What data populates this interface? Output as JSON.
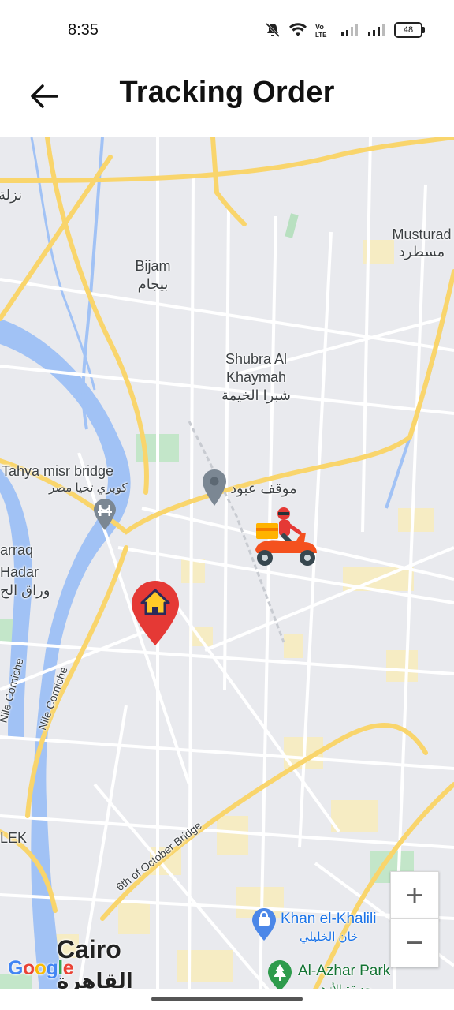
{
  "status": {
    "time": "8:35",
    "battery": "48",
    "icons": [
      "mute-icon",
      "wifi-icon",
      "volte-icon",
      "signal-icon",
      "signal-icon",
      "battery-icon"
    ]
  },
  "header": {
    "title": "Tracking Order",
    "back_icon": "arrow-left-icon"
  },
  "map": {
    "labels": {
      "nazla": "نزلة",
      "musturad_en": "Musturad",
      "musturad_ar": "مسطرد",
      "bijam_en": "Bijam",
      "bijam_ar": "بيجام",
      "shubra_en_1": "Shubra Al",
      "shubra_en_2": "Khaymah",
      "shubra_ar": "شبرا الخيمة",
      "bridge_en": "Tahya misr bridge",
      "bridge_ar": "كوبري تحيا مصر",
      "mawkif": "موقف عبود",
      "warraq_1": "arraq",
      "warraq_2": "Hadar",
      "warraq_ar": "وراق الح",
      "corniche_1": "Nile Corniche",
      "corniche_2": "Nile Corniche",
      "october_bridge": "6th of October Bridge",
      "zamalek": "LEK",
      "khan_en": "Khan el-Khalili",
      "khan_ar": "خان الخليلي",
      "azhar_en": "Al-Azhar Park",
      "azhar_ar": "حديقة الأزهر",
      "cairo_en": "Cairo",
      "cairo_ar": "القاهرة"
    },
    "markers": {
      "home": "home-marker-icon",
      "courier": "delivery-scooter-icon",
      "transit": "location-pin-icon",
      "bridge_poi": "bridge-icon",
      "shopping_poi": "shopping-bag-icon",
      "park_poi": "tree-icon"
    },
    "zoom_in": "+",
    "zoom_out": "−",
    "attribution": "Google",
    "colors": {
      "water": "#a1c2f5",
      "highway": "#f9d56c",
      "park": "#a8dab5",
      "home_pin": "#e53935",
      "courier": "#f4511e"
    }
  }
}
